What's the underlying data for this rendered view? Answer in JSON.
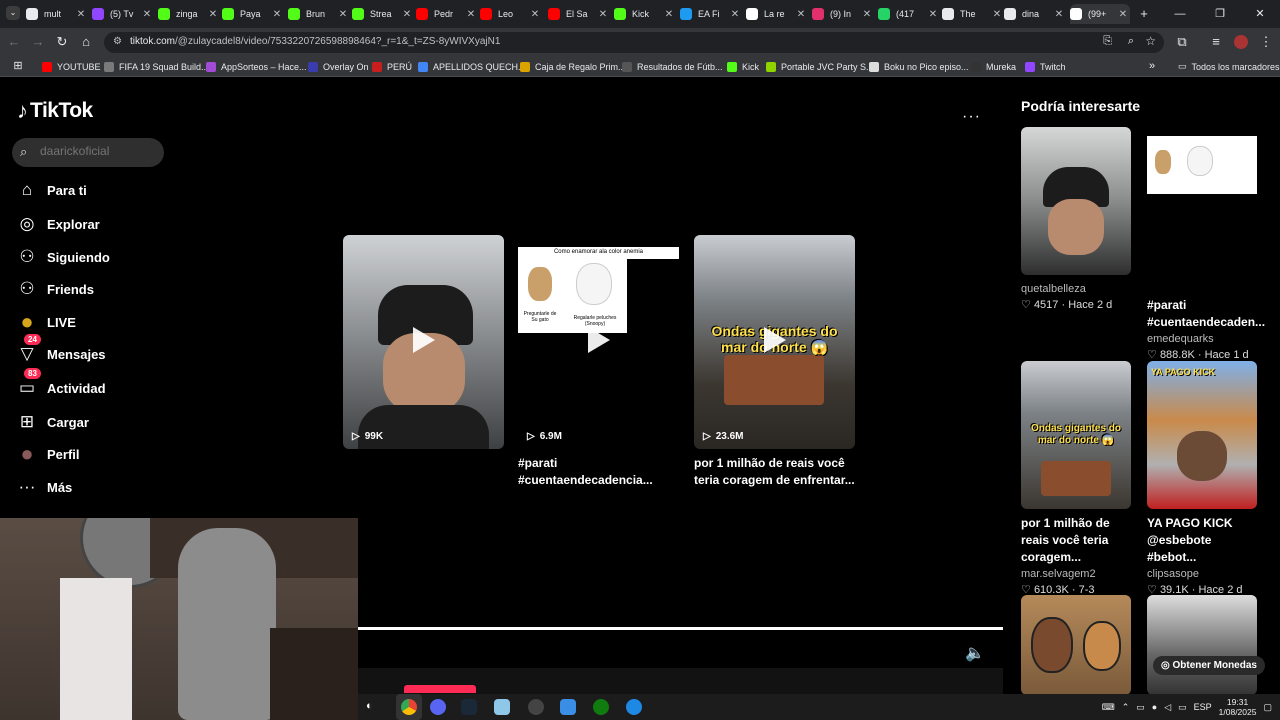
{
  "browser": {
    "tabs": [
      {
        "label": "mult",
        "color": "#e8eaed"
      },
      {
        "label": "(5) Tv",
        "color": "#9146ff"
      },
      {
        "label": "zinga",
        "color": "#53fc18"
      },
      {
        "label": "Paya",
        "color": "#53fc18"
      },
      {
        "label": "Brun",
        "color": "#53fc18"
      },
      {
        "label": "Strea",
        "color": "#53fc18"
      },
      {
        "label": "Pedr",
        "color": "#ff0000"
      },
      {
        "label": "Leo",
        "color": "#ff0000"
      },
      {
        "label": "El Sa",
        "color": "#ff0000"
      },
      {
        "label": "Kick",
        "color": "#53fc18"
      },
      {
        "label": "EA Fi",
        "color": "#1d9bf0"
      },
      {
        "label": "La re",
        "color": "#ffffff"
      },
      {
        "label": "(9) In",
        "color": "#e1306c"
      },
      {
        "label": "(417",
        "color": "#25d366"
      },
      {
        "label": "The",
        "color": "#e8eaed"
      },
      {
        "label": "dina",
        "color": "#e8eaed"
      },
      {
        "label": "(99+",
        "color": "#ffffff"
      }
    ],
    "url_host": "tiktok.com",
    "url_path": "/@zulaycadel8/video/7533220726598898464?_r=1&_t=ZS-8yWIVXyajN1",
    "bookmarks": [
      {
        "label": "YOUTUBE",
        "color": "#ff0000"
      },
      {
        "label": "FIFA 19 Squad Build...",
        "color": "#7a7a7a"
      },
      {
        "label": "AppSorteos – Hace...",
        "color": "#a24bd6"
      },
      {
        "label": "Overlay On",
        "color": "#3b3bb0"
      },
      {
        "label": "PERÚ",
        "color": "#c81e1e"
      },
      {
        "label": "APELLIDOS QUECH...",
        "color": "#4285f4"
      },
      {
        "label": "Caja de Regalo Prim...",
        "color": "#d9a400"
      },
      {
        "label": "Resultados de Fútb...",
        "color": "#555555"
      },
      {
        "label": "Kick",
        "color": "#53fc18"
      },
      {
        "label": "Portable JVC Party S...",
        "color": "#8fd400"
      },
      {
        "label": "Boku no Pico episo...",
        "color": "#dddddd"
      },
      {
        "label": "Mureka",
        "color": "#333333"
      },
      {
        "label": "Twitch",
        "color": "#9146ff"
      }
    ],
    "all_bookmarks": "Todos los marcadores"
  },
  "sidebar": {
    "logo": "TikTok",
    "search_placeholder": "daarickoficial",
    "items": [
      {
        "label": "Para ti",
        "icon": "home-icon",
        "glyph": "⌂"
      },
      {
        "label": "Explorar",
        "icon": "compass-icon",
        "glyph": "◎"
      },
      {
        "label": "Siguiendo",
        "icon": "following-icon",
        "glyph": "⚇"
      },
      {
        "label": "Friends",
        "icon": "friends-icon",
        "glyph": "⚇"
      },
      {
        "label": "LIVE",
        "icon": "live-icon",
        "glyph": "●"
      },
      {
        "label": "Mensajes",
        "icon": "messages-icon",
        "glyph": "▽",
        "badge": "24"
      },
      {
        "label": "Actividad",
        "icon": "activity-icon",
        "glyph": "▭",
        "badge": "83"
      },
      {
        "label": "Cargar",
        "icon": "upload-icon",
        "glyph": "⊞"
      },
      {
        "label": "Perfil",
        "icon": "profile-avatar-icon",
        "glyph": "●"
      },
      {
        "label": "Más",
        "icon": "more-icon",
        "glyph": "···"
      }
    ]
  },
  "videos": [
    {
      "views": "99K",
      "caption": "",
      "thumb": "#6b6f74"
    },
    {
      "views": "6.9M",
      "caption": "#parati #cuentaendecadencia...",
      "thumb": "#000000",
      "overlay_title": "Como enamorar ala color anemia",
      "overlay_left": "Preguntarle de Su gato",
      "overlay_right": "Regalarle peluches (Snoopy)"
    },
    {
      "views": "23.6M",
      "caption": "por 1 milhão de reais você teria coragem de enfrentar...",
      "thumb": "#4a4e52",
      "overlay_text": "Ondas gigantes do mar do norte 😱"
    }
  ],
  "more_menu": "···",
  "rail": {
    "title": "Podría interesarte",
    "items": [
      {
        "title": "",
        "user": "quetalbelleza",
        "likes": "4517",
        "age": "Hace 2 d",
        "thumb": "#8a8c8c"
      },
      {
        "title": "#parati #cuentaendecaden...",
        "user": "emedequarks",
        "likes": "888.8K",
        "age": "Hace 1 d",
        "thumb": "#000000"
      },
      {
        "title": "por 1 milhão de reais você teria coragem...",
        "user": "mar.selvagem2",
        "likes": "610.3K",
        "age": "7-3",
        "thumb": "#4a4e52",
        "overlay_text": "Ondas gigantes do mar do norte 😱"
      },
      {
        "title": "YA PAGO KICK @esbebote #bebot...",
        "user": "clipsasope",
        "likes": "39.1K",
        "age": "Hace 2 d",
        "thumb": "#6a8fbf",
        "overlay_text": "YA PAGO KICK"
      },
      {
        "title": "",
        "user": "",
        "likes": "",
        "age": "",
        "thumb": "#8a6b4a"
      },
      {
        "title": "",
        "user": "",
        "likes": "",
        "age": "",
        "thumb": "#555555"
      }
    ],
    "coins_label": "Obtener Monedas"
  },
  "taskbar": {
    "lang": "ESP",
    "time": "19:31",
    "date": "1/08/2025"
  }
}
